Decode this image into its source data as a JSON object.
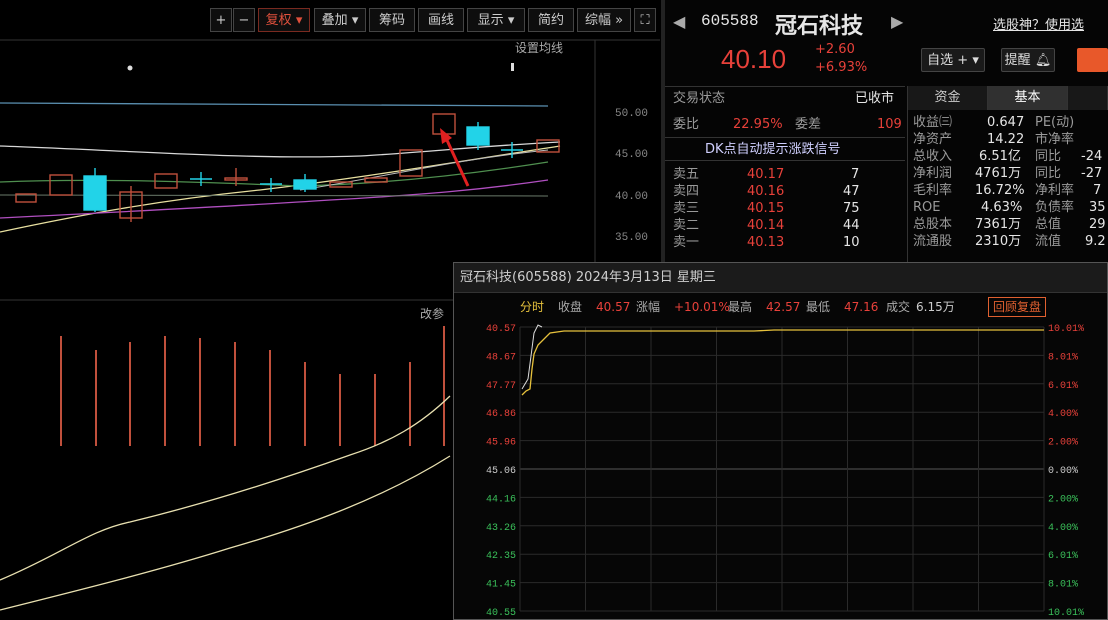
{
  "toolbar": {
    "plus": "+",
    "minus": "−",
    "fuquan": "复权",
    "diejia": "叠加",
    "chouma": "筹码",
    "huaxian": "画线",
    "xianshi": "显示",
    "jianyue": "简约",
    "zongfu": "综幅"
  },
  "kline": {
    "ma_label": "设置均线",
    "y_ticks": [
      "50.00",
      "45.00",
      "40.00",
      "35.00"
    ],
    "lower_label": "改参"
  },
  "stock": {
    "code": "605588",
    "name": "冠石科技",
    "price": "40.10",
    "change": "+2.60",
    "change_pct": "+6.93%",
    "top_link": "选股神？使用选"
  },
  "buttons": {
    "zixuan": "自选",
    "tixing": "提醒"
  },
  "status": {
    "label": "交易状态",
    "value": "已收市",
    "weibi_label": "委比",
    "weibi_value": "22.95%",
    "weicha_label": "委差",
    "weicha_value": "109",
    "signal": "DK点自动提示涨跌信号"
  },
  "orderbook": [
    {
      "label": "卖五",
      "price": "40.17",
      "vol": "7"
    },
    {
      "label": "卖四",
      "price": "40.16",
      "vol": "47"
    },
    {
      "label": "卖三",
      "price": "40.15",
      "vol": "75"
    },
    {
      "label": "卖二",
      "price": "40.14",
      "vol": "44"
    },
    {
      "label": "卖一",
      "price": "40.13",
      "vol": "10"
    }
  ],
  "tabs": [
    "资金",
    "基本"
  ],
  "fundamentals": [
    {
      "label": "收益㈢",
      "value": "0.647",
      "label2": "PE(动)",
      "value2": ""
    },
    {
      "label": "净资产",
      "value": "14.22",
      "label2": "市净率",
      "value2": ""
    },
    {
      "label": "总收入",
      "value": "6.51亿",
      "label2": "同比",
      "value2": "-24"
    },
    {
      "label": "净利润",
      "value": "4761万",
      "label2": "同比",
      "value2": "-27"
    },
    {
      "label": "毛利率",
      "value": "16.72%",
      "label2": "净利率",
      "value2": "7"
    },
    {
      "label": "ROE",
      "value": "4.63%",
      "label2": "负债率",
      "value2": "35"
    },
    {
      "label": "总股本",
      "value": "7361万",
      "label2": "总值",
      "value2": "29"
    },
    {
      "label": "流通股",
      "value": "2310万",
      "label2": "流值",
      "value2": "9.2"
    }
  ],
  "popup": {
    "title": "冠石科技(605588) 2024年3月13日 星期三",
    "fenshi": "分时",
    "close_label": "收盘",
    "close_value": "40.57",
    "zhangfu_label": "涨幅",
    "zhangfu_value": "+10.01%",
    "high_label": "最高",
    "high_value": "42.57",
    "low_label": "最低",
    "low_value": "47.16",
    "volume_label": "成交",
    "volume_value": "6.15万",
    "replay": "回顾复盘",
    "left_ticks": [
      "40.57",
      "48.67",
      "47.77",
      "46.86",
      "45.96",
      "45.06",
      "44.16",
      "43.26",
      "42.35",
      "41.45",
      "40.55"
    ],
    "right_ticks": [
      "10.01%",
      "8.01%",
      "6.01%",
      "4.00%",
      "2.00%",
      "0.00%",
      "2.00%",
      "4.00%",
      "6.01%",
      "8.01%",
      "10.01%"
    ]
  }
}
